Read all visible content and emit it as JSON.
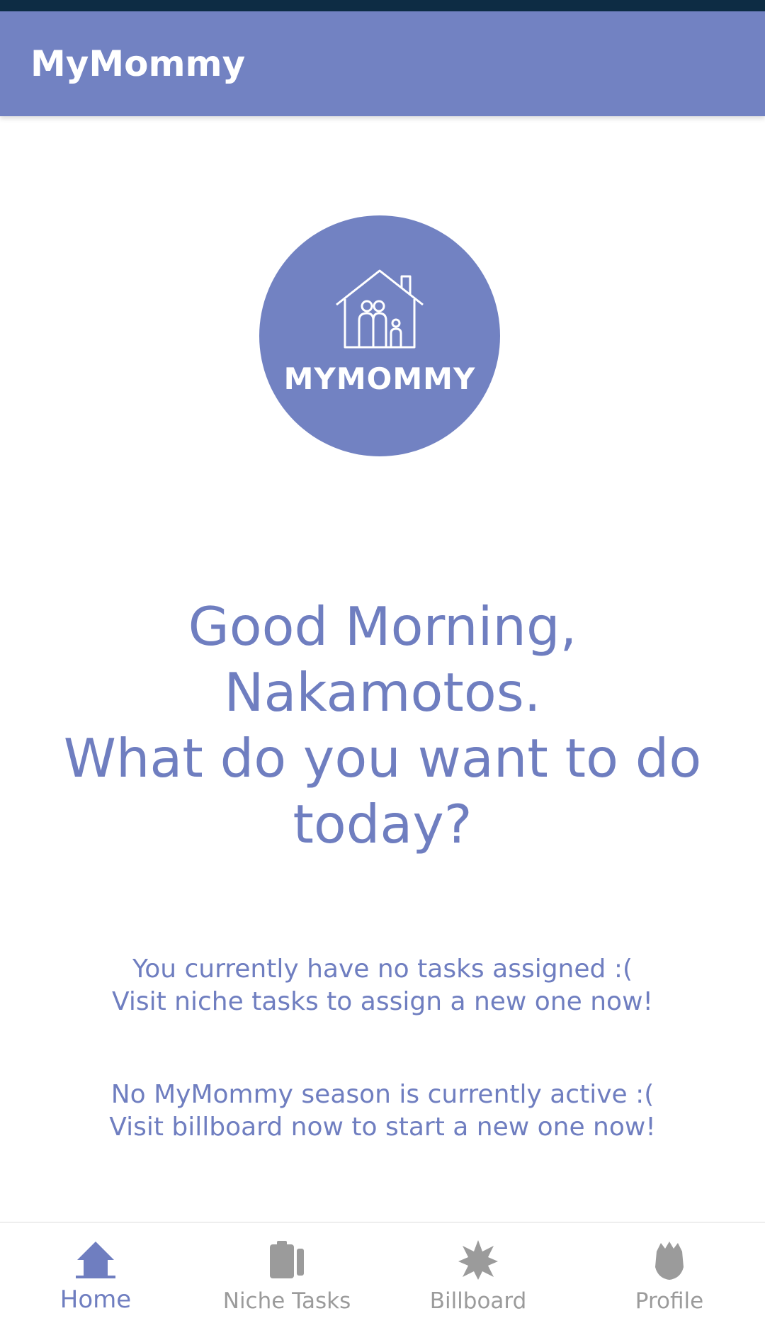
{
  "app": {
    "title": "MyMommy"
  },
  "logo": {
    "text": "MYMOMMY",
    "icon": "house-family-icon"
  },
  "greeting": {
    "line1": "Good Morning,",
    "line2": "Nakamotos.",
    "line3": "What do you want to do",
    "line4": "today?"
  },
  "tasks_info": {
    "line1": "You currently have no tasks assigned :(",
    "line2": "Visit niche tasks to assign a new one now!"
  },
  "season_info": {
    "line1": "No MyMommy season is currently active :(",
    "line2": "Visit billboard now to start a new one now!"
  },
  "bottom_nav": {
    "items": [
      {
        "label": "Home",
        "icon": "home-icon",
        "active": true
      },
      {
        "label": "Niche Tasks",
        "icon": "tasks-icon",
        "active": false
      },
      {
        "label": "Billboard",
        "icon": "billboard-icon",
        "active": false
      },
      {
        "label": "Profile",
        "icon": "profile-icon",
        "active": false
      }
    ]
  },
  "colors": {
    "primary": "#7282c2",
    "text_primary": "#6f7ec0",
    "inactive": "#9b9b9b",
    "status_bar": "#0d2c44"
  }
}
